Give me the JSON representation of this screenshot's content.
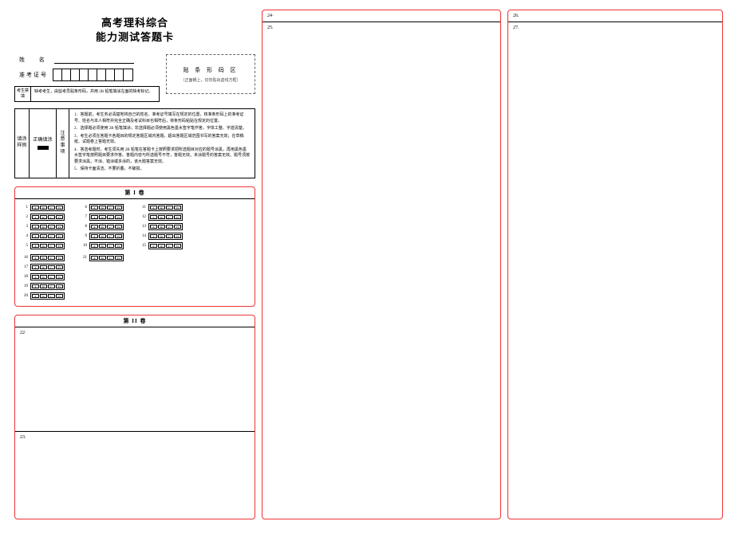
{
  "title": {
    "line1": "高考理科综合",
    "line2": "能力测试答题卡"
  },
  "name_label": "姓 名",
  "ticket_label": "准考证号",
  "ticket_cells": 9,
  "examinee_note": {
    "side": "考生禁填",
    "body": "缺考考生，由监考员贴条形码，并用 2B 铅笔填涂左面的缺考标记。"
  },
  "barcode": {
    "title": "贴 条 形 码 区",
    "subtitle": "（正面朝上，切勿贴出虚线方框）"
  },
  "rules": {
    "col1": "填涂样例",
    "col2_label": "正确填涂",
    "col3": "注意事项",
    "items": [
      "1．答题前，考生务必清楚地将自己的姓名、准考证号填写在规定的位置，核准条形码上的准考证号、姓名与本人相符并完全正确及考试科目也相符后，将条形码粘贴在规定的位置。",
      "2．选择题必须使用 2B 铅笔填涂；非选择题必须使用黑色墨水签字笔作答，字体工整、字迹清楚。",
      "3．考生必须在答题卡各题目的规定答题区域内答题，超出答题区域范围书写的答案无效；在草稿纸、试题卷上答题无效。",
      "4．答选考题时，考生须先用 2B 铅笔在答题卡上按照要求把所选题目对应的题号涂黑，再用黑色墨水签字笔按照题目要求作答。答题内容与所选题号不符，答题无效。未涂题号的答案无效。题号须按要求涂黑，不涂、错涂或多涂的，该大题答案无效。",
      "5．保持卡面清洁，不要折叠，不破损。"
    ]
  },
  "paper1": {
    "header": "第 I 卷",
    "options4": [
      "A",
      "B",
      "C",
      "D"
    ],
    "options3": [
      "A",
      "B",
      "C"
    ],
    "col_a": [
      1,
      2,
      3,
      4,
      5
    ],
    "col_b": [
      6,
      7,
      8,
      9,
      10
    ],
    "col_c": [
      11,
      12,
      13,
      14,
      15
    ],
    "col_d": [
      16,
      17,
      18,
      19,
      20
    ],
    "col_e": [
      21
    ]
  },
  "paper2": {
    "header": "第 II 卷",
    "questions": [
      "22·",
      "23."
    ]
  },
  "col2_questions": [
    "24·",
    "25."
  ],
  "col3_questions": [
    "26.",
    "27."
  ]
}
